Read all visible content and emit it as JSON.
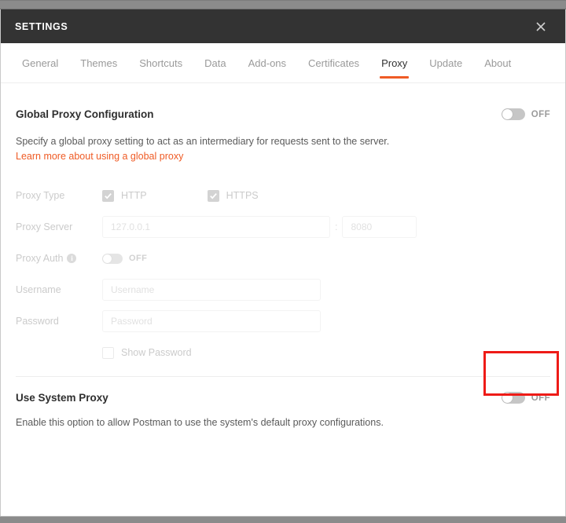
{
  "window": {
    "title": "SETTINGS",
    "close_icon": "close-icon"
  },
  "tabs": [
    {
      "label": "General",
      "active": false
    },
    {
      "label": "Themes",
      "active": false
    },
    {
      "label": "Shortcuts",
      "active": false
    },
    {
      "label": "Data",
      "active": false
    },
    {
      "label": "Add-ons",
      "active": false
    },
    {
      "label": "Certificates",
      "active": false
    },
    {
      "label": "Proxy",
      "active": true
    },
    {
      "label": "Update",
      "active": false
    },
    {
      "label": "About",
      "active": false
    }
  ],
  "global_proxy": {
    "title": "Global Proxy Configuration",
    "toggle_state": "OFF",
    "description": "Specify a global proxy setting to act as an intermediary for requests sent to the server.",
    "link_text": "Learn more about using a global proxy"
  },
  "form": {
    "proxy_type": {
      "label": "Proxy Type",
      "options": [
        {
          "label": "HTTP",
          "checked": true
        },
        {
          "label": "HTTPS",
          "checked": true
        }
      ]
    },
    "proxy_server": {
      "label": "Proxy Server",
      "host_placeholder": "127.0.0.1",
      "host_value": "",
      "separator": ":",
      "port_placeholder": "8080",
      "port_value": ""
    },
    "proxy_auth": {
      "label": "Proxy Auth",
      "info_icon": "info-icon",
      "info_glyph": "i",
      "toggle_state": "OFF"
    },
    "username": {
      "label": "Username",
      "placeholder": "Username",
      "value": ""
    },
    "password": {
      "label": "Password",
      "placeholder": "Password",
      "value": ""
    },
    "show_password": {
      "label": "Show Password",
      "checked": false
    }
  },
  "system_proxy": {
    "title": "Use System Proxy",
    "toggle_state": "OFF",
    "description": "Enable this option to allow Postman to use the system's default proxy configurations."
  },
  "annotation": {
    "highlight_color": "#ee1b17",
    "target": "use-system-proxy-toggle"
  },
  "colors": {
    "accent": "#ef5b25",
    "titlebar": "#333333",
    "link": "#ef5b25",
    "highlight": "#ee1b17"
  }
}
